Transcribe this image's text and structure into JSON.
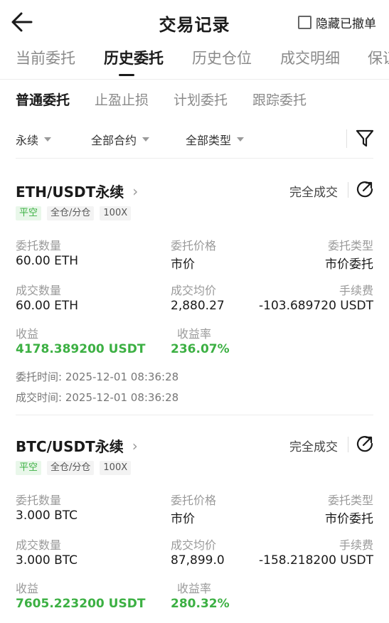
{
  "header": {
    "title": "交易记录",
    "hide_cancelled_label": "隐藏已撤单",
    "hide_cancelled_checked": false
  },
  "tabs": [
    {
      "label": "当前委托",
      "active": false
    },
    {
      "label": "历史委托",
      "active": true
    },
    {
      "label": "历史仓位",
      "active": false
    },
    {
      "label": "成交明细",
      "active": false
    },
    {
      "label": "保证",
      "active": false
    }
  ],
  "subtabs": [
    {
      "label": "普通委托",
      "active": true
    },
    {
      "label": "止盈止损",
      "active": false
    },
    {
      "label": "计划委托",
      "active": false
    },
    {
      "label": "跟踪委托",
      "active": false
    }
  ],
  "filters": {
    "contract_type": "永续",
    "contract": "全部合约",
    "order_type": "全部类型"
  },
  "labels": {
    "order_qty": "委托数量",
    "order_price": "委托价格",
    "order_type": "委托类型",
    "filled_qty": "成交数量",
    "avg_price": "成交均价",
    "fee": "手续费",
    "pnl": "收益",
    "pnl_rate": "收益率",
    "order_time": "委托时间:",
    "fill_time": "成交时间:"
  },
  "orders": [
    {
      "symbol": "ETH/USDT永续",
      "status": "完全成交",
      "side": "平空",
      "margin_mode": "全仓/分仓",
      "leverage": "100X",
      "order_qty": "60.00 ETH",
      "order_price": "市价",
      "order_type": "市价委托",
      "filled_qty": "60.00 ETH",
      "avg_price": "2,880.27",
      "fee": "-103.689720 USDT",
      "pnl": "4178.389200 USDT",
      "pnl_rate": "236.07%",
      "order_time": "2025-12-01 08:36:28",
      "fill_time": "2025-12-01 08:36:28"
    },
    {
      "symbol": "BTC/USDT永续",
      "status": "完全成交",
      "side": "平空",
      "margin_mode": "全仓/分仓",
      "leverage": "100X",
      "order_qty": "3.000 BTC",
      "order_price": "市价",
      "order_type": "市价委托",
      "filled_qty": "3.000 BTC",
      "avg_price": "87,899.0",
      "fee": "-158.218200 USDT",
      "pnl": "7605.223200 USDT",
      "pnl_rate": "280.32%"
    }
  ],
  "colors": {
    "accent_green": "#3cb043",
    "tag_green_bg": "#e9f7ea",
    "text_primary": "#1a1a1a",
    "text_secondary": "#9a9a9a"
  },
  "icons": {
    "back": "arrow-left-icon",
    "filter": "funnel-icon",
    "share": "share-refresh-icon",
    "chevron": "chevron-right-icon",
    "checkbox": "checkbox-icon"
  }
}
